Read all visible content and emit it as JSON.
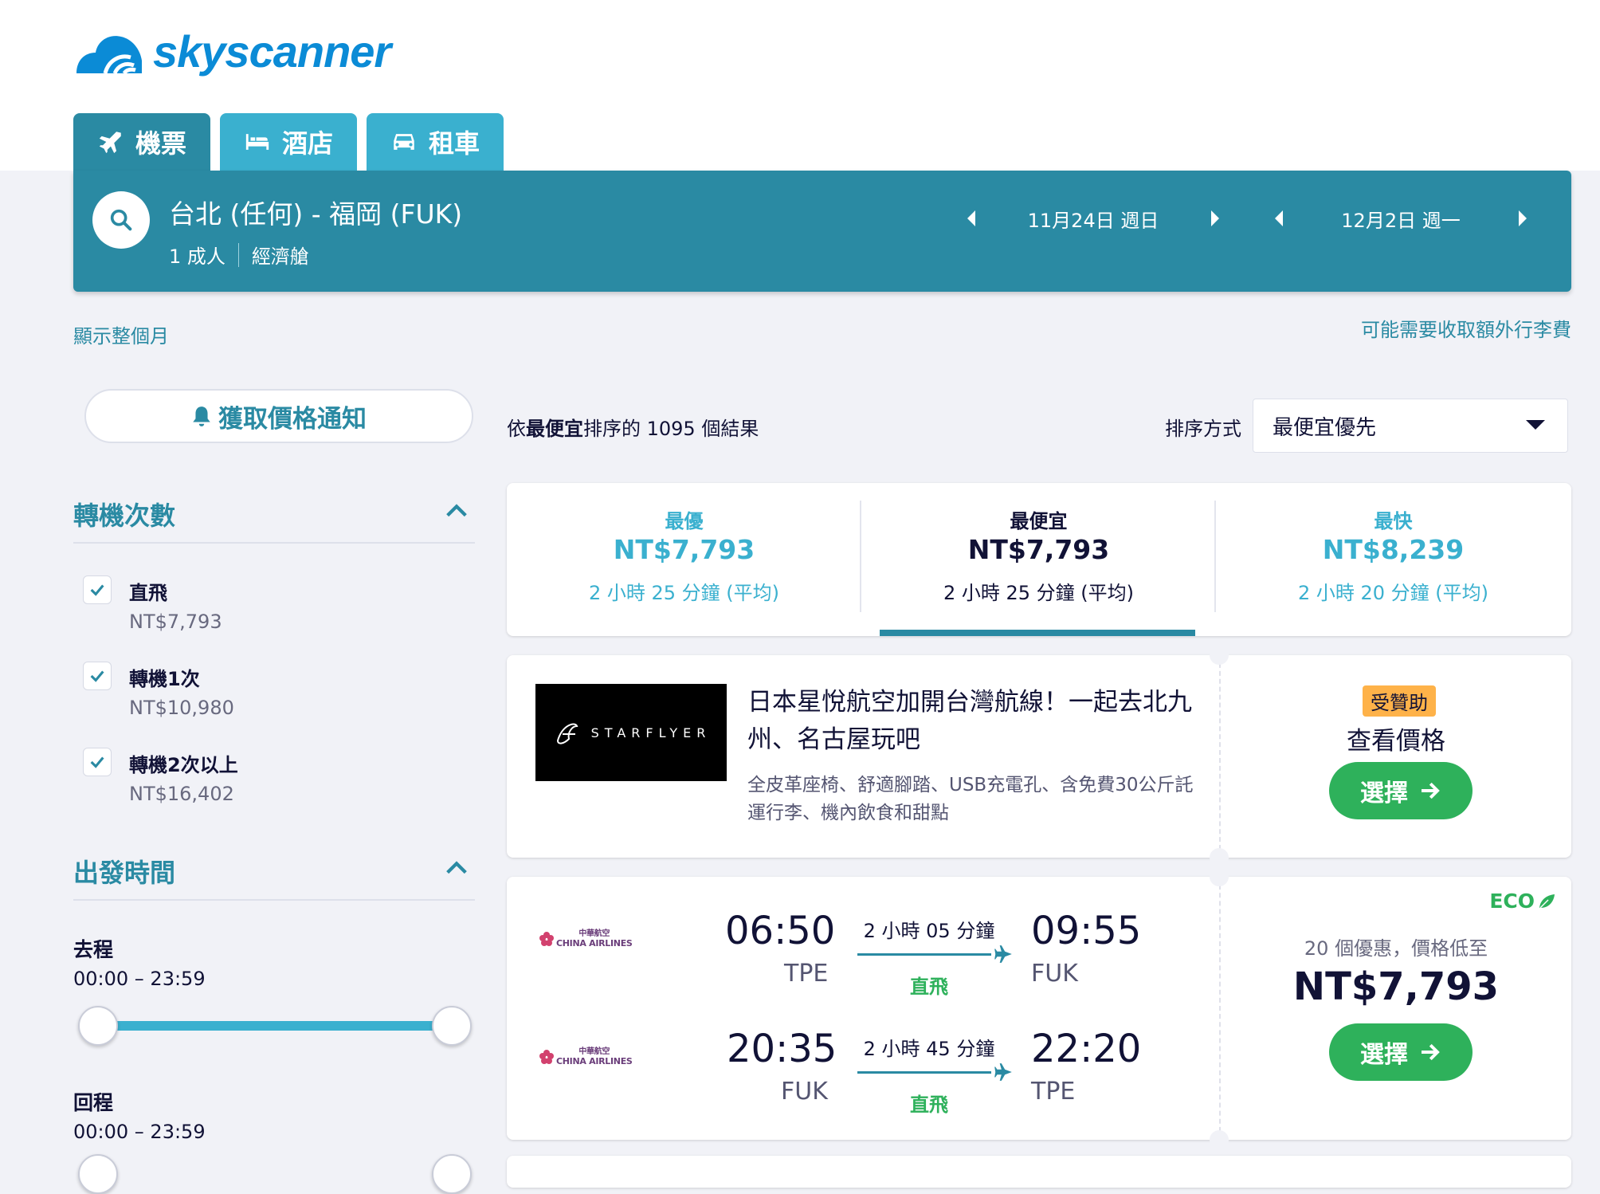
{
  "brand": {
    "name": "skyscanner",
    "color": "#0b8bd6"
  },
  "tabs": [
    {
      "label": "機票",
      "icon": "plane-icon",
      "active": true
    },
    {
      "label": "酒店",
      "icon": "bed-icon",
      "active": false
    },
    {
      "label": "租車",
      "icon": "car-icon",
      "active": false
    }
  ],
  "search": {
    "route": "台北 (任何) - 福岡 (FUK)",
    "travellers": "1 成人",
    "cabin": "經濟艙",
    "depart_date": "11月24日 週日",
    "return_date": "12月2日 週一"
  },
  "links": {
    "show_month": "顯示整個月",
    "baggage_fee": "可能需要收取額外行李費"
  },
  "price_alert": {
    "label": "獲取價格通知"
  },
  "filters": {
    "stops": {
      "title": "轉機次數",
      "items": [
        {
          "label": "直飛",
          "price": "NT$7,793",
          "checked": true
        },
        {
          "label": "轉機1次",
          "price": "NT$10,980",
          "checked": true
        },
        {
          "label": "轉機2次以上",
          "price": "NT$16,402",
          "checked": true
        }
      ]
    },
    "times": {
      "title": "出發時間",
      "outbound_label": "去程",
      "outbound_range": "00:00 – 23:59",
      "return_label": "回程",
      "return_range": "00:00 – 23:59"
    }
  },
  "results": {
    "prefix": "依",
    "sort_word": "最便宜",
    "suffix": "排序的 1095 個結果",
    "sort_label": "排序方式",
    "sort_value": "最便宜優先"
  },
  "summary": [
    {
      "title": "最優",
      "price": "NT$7,793",
      "duration": "2 小時 25 分鐘 (平均)",
      "selected": false
    },
    {
      "title": "最便宜",
      "price": "NT$7,793",
      "duration": "2 小時 25 分鐘 (平均)",
      "selected": true
    },
    {
      "title": "最快",
      "price": "NT$8,239",
      "duration": "2 小時 20 分鐘 (平均)",
      "selected": false
    }
  ],
  "ad": {
    "logo_text": "STARFLYER",
    "title": "日本星悅航空加開台灣航線！一起去北九州、名古屋玩吧",
    "description": "全皮革座椅、舒適腳踏、USB充電孔、含免費30公斤託運行李、機內飲食和甜點",
    "sponsored": "受贊助",
    "view_price": "查看價格",
    "select": "選擇"
  },
  "flight": {
    "eco_label": "ECO",
    "deals": "20 個優惠，價格低至",
    "price": "NT$7,793",
    "select": "選擇",
    "legs": [
      {
        "airline": "CHINA AIRLINES",
        "airline_cn": "中華航空",
        "depart_time": "06:50",
        "depart_code": "TPE",
        "duration": "2 小時 05 分鐘",
        "stops": "直飛",
        "arrive_time": "09:55",
        "arrive_code": "FUK"
      },
      {
        "airline": "CHINA AIRLINES",
        "airline_cn": "中華航空",
        "depart_time": "20:35",
        "depart_code": "FUK",
        "duration": "2 小時 45 分鐘",
        "stops": "直飛",
        "arrive_time": "22:20",
        "arrive_code": "TPE"
      }
    ]
  },
  "colors": {
    "primary": "#2a8aa3",
    "tab_inactive": "#3ab0cf",
    "accent_blue": "#3ab0cf",
    "green": "#2eb15b",
    "sponsor": "#feb249",
    "background": "#f1f2f7"
  }
}
